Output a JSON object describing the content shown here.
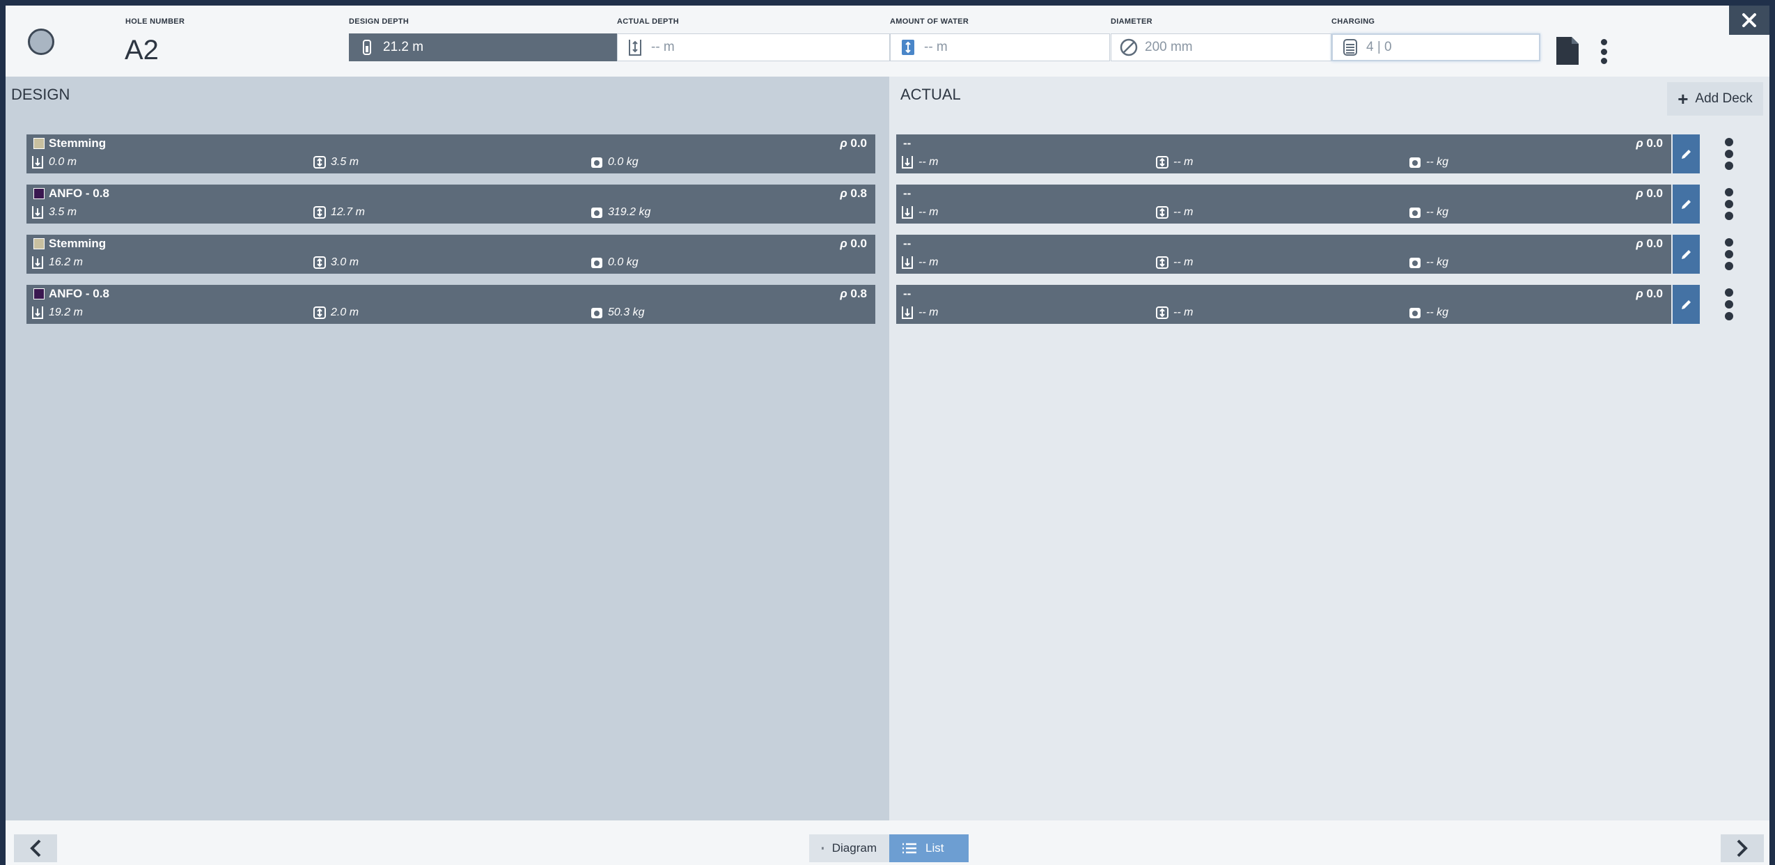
{
  "header": {
    "hole_number_label": "HOLE NUMBER",
    "hole_number": "A2",
    "design_depth_label": "DESIGN DEPTH",
    "design_depth": "21.2 m",
    "actual_depth_label": "ACTUAL DEPTH",
    "actual_depth": "-- m",
    "water_label": "AMOUNT OF WATER",
    "water": "-- m",
    "diameter_label": "DIAMETER",
    "diameter": "200 mm",
    "charging_label": "CHARGING",
    "charging": "4  |  0"
  },
  "design": {
    "title": "DESIGN",
    "decks": [
      {
        "name": "Stemming",
        "color": "#c8c0a0",
        "rho": "0.0",
        "top": "0.0 m",
        "length": "3.5 m",
        "mass": "0.0 kg"
      },
      {
        "name": "ANFO - 0.8",
        "color": "#3a1850",
        "rho": "0.8",
        "top": "3.5 m",
        "length": "12.7 m",
        "mass": "319.2 kg"
      },
      {
        "name": "Stemming",
        "color": "#c8c0a0",
        "rho": "0.0",
        "top": "16.2 m",
        "length": "3.0 m",
        "mass": "0.0 kg"
      },
      {
        "name": "ANFO - 0.8",
        "color": "#3a1850",
        "rho": "0.8",
        "top": "19.2 m",
        "length": "2.0 m",
        "mass": "50.3 kg"
      }
    ]
  },
  "actual": {
    "title": "ACTUAL",
    "add_deck_label": "Add Deck",
    "decks": [
      {
        "name": "--",
        "rho": "0.0",
        "top": "-- m",
        "length": "-- m",
        "mass": "-- kg"
      },
      {
        "name": "--",
        "rho": "0.0",
        "top": "-- m",
        "length": "-- m",
        "mass": "-- kg"
      },
      {
        "name": "--",
        "rho": "0.0",
        "top": "-- m",
        "length": "-- m",
        "mass": "-- kg"
      },
      {
        "name": "--",
        "rho": "0.0",
        "top": "-- m",
        "length": "-- m",
        "mass": "-- kg"
      }
    ]
  },
  "footer": {
    "diagram_label": "Diagram",
    "list_label": "List"
  },
  "colors": {
    "accent": "#4472a4",
    "deck_bg": "#5d6b7a",
    "toggle_active": "#6d9ed2"
  }
}
